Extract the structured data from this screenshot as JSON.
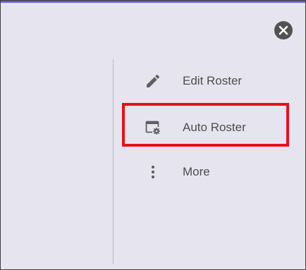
{
  "panel": {
    "close_icon": "close-circle-icon",
    "accent_color": "#6b62c8",
    "highlight_color": "#e8101b"
  },
  "menu": {
    "items": [
      {
        "label": "Edit Roster",
        "icon": "pencil-icon"
      },
      {
        "label": "Auto Roster",
        "icon": "calendar-gear-icon"
      },
      {
        "label": "More",
        "icon": "more-vertical-icon"
      }
    ]
  }
}
